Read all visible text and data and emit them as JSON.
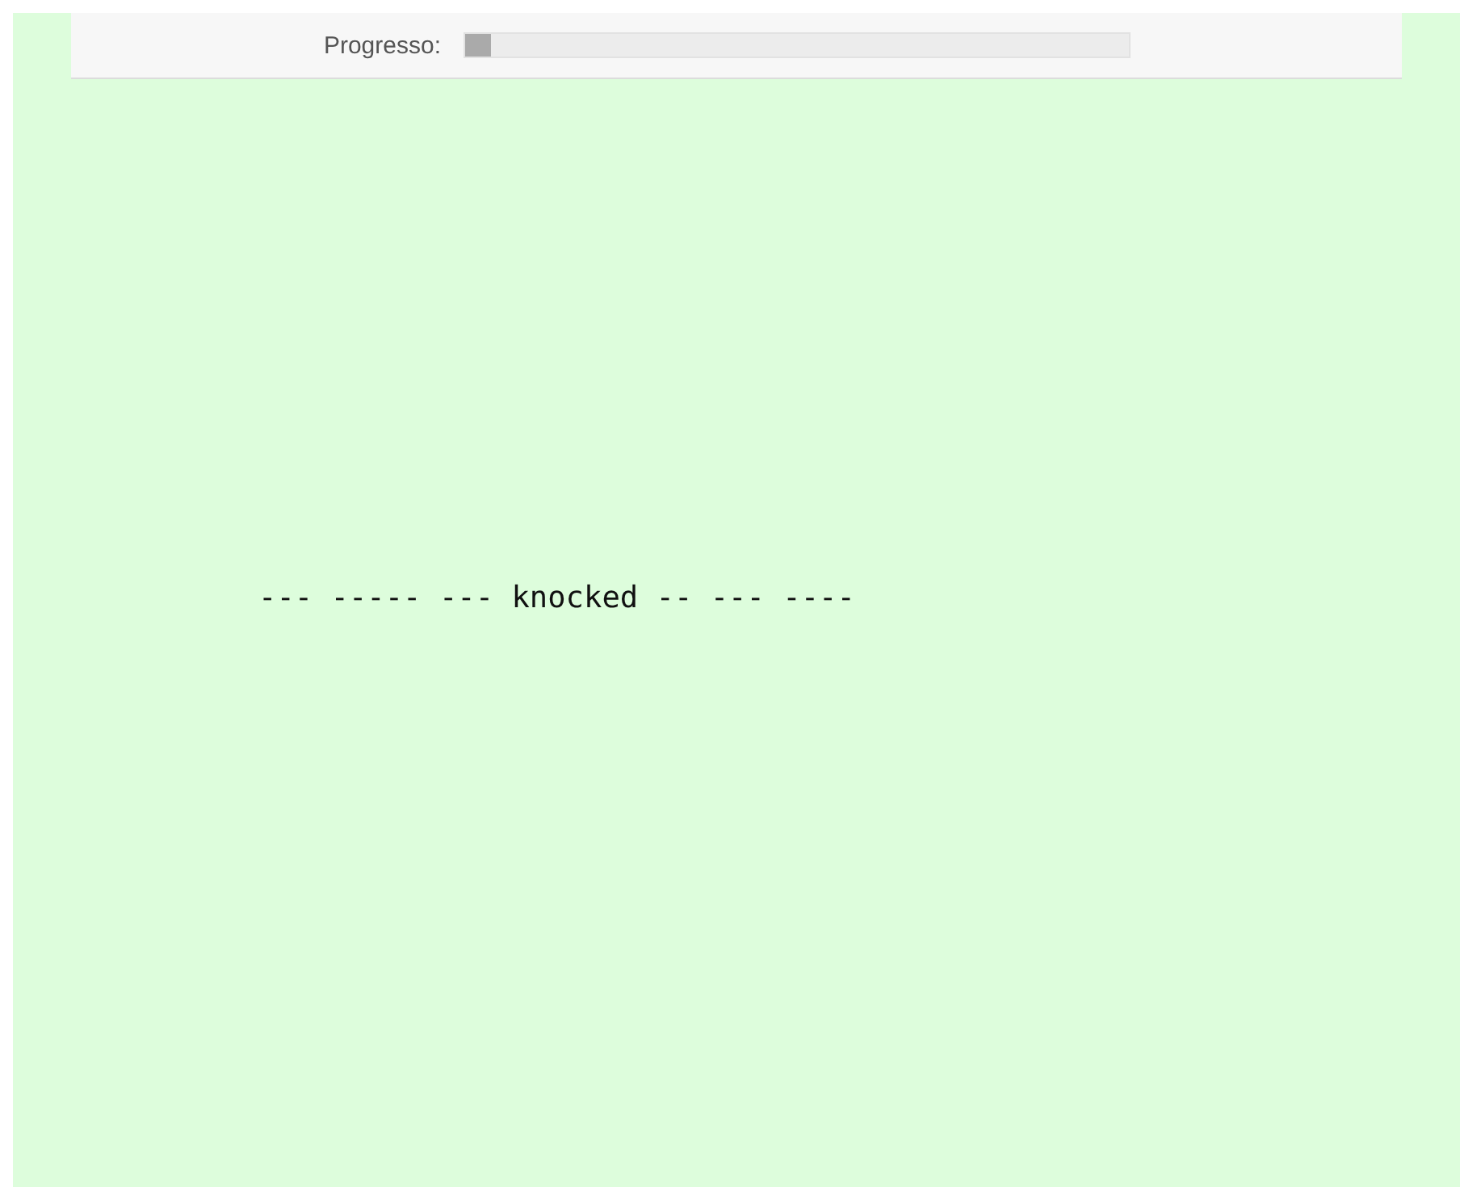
{
  "progress_bar": {
    "label": "Progresso:",
    "level": 0.04
  },
  "sentence": "--- ----- --- knocked -- --- ----"
}
